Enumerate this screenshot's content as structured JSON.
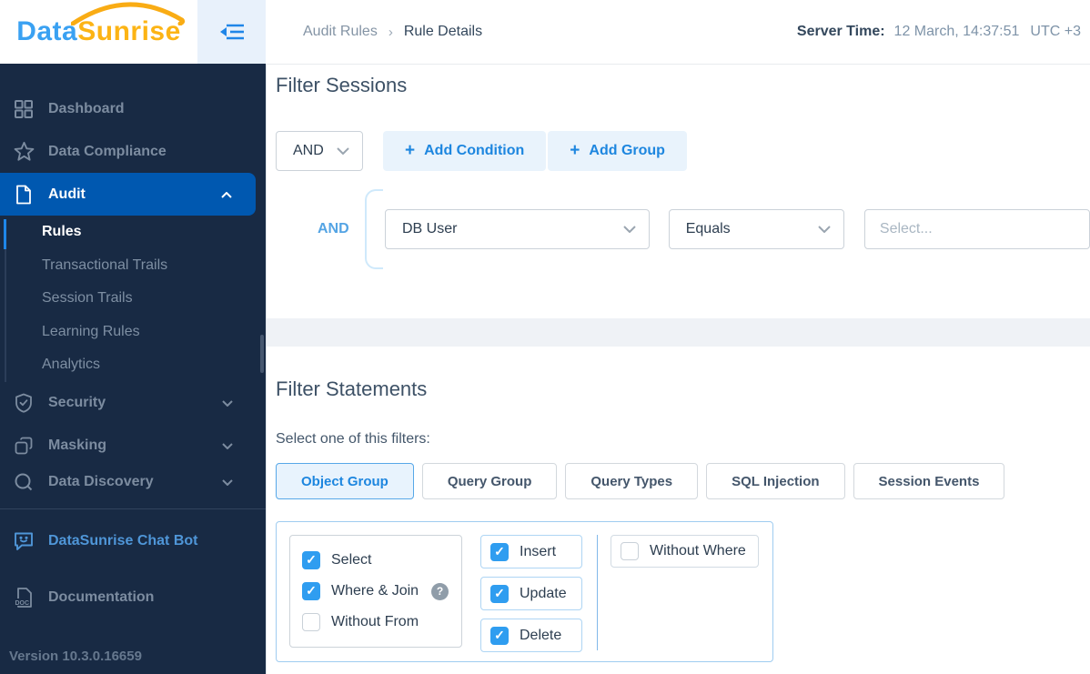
{
  "header": {
    "logo": {
      "part1": "Data",
      "part2": "Sunrise"
    },
    "breadcrumb": {
      "parent": "Audit Rules",
      "separator": "›",
      "current": "Rule Details"
    },
    "server_time_label": "Server Time:",
    "server_time_value": "12 March, 14:37:51",
    "server_time_zone": "UTC +3"
  },
  "sidebar": {
    "items": [
      {
        "label": "Dashboard",
        "icon": "dashboard-grid-icon",
        "active": false
      },
      {
        "label": "Data Compliance",
        "icon": "star-icon",
        "active": false
      },
      {
        "label": "Audit",
        "icon": "document-icon",
        "active": true,
        "expanded": true
      },
      {
        "label": "Security",
        "icon": "shield-check-icon",
        "active": false
      },
      {
        "label": "Masking",
        "icon": "masking-icon",
        "active": false
      },
      {
        "label": "Data Discovery",
        "icon": "search-icon",
        "active": false
      }
    ],
    "audit_subitems": [
      {
        "label": "Rules",
        "active": true
      },
      {
        "label": "Transactional Trails",
        "active": false
      },
      {
        "label": "Session Trails",
        "active": false
      },
      {
        "label": "Learning Rules",
        "active": false
      },
      {
        "label": "Analytics",
        "active": false
      }
    ],
    "footer_items": [
      {
        "label": "DataSunrise Chat Bot",
        "icon": "chat-bot-icon"
      },
      {
        "label": "Documentation",
        "icon": "doc-file-icon"
      }
    ],
    "version": "Version 10.3.0.16659"
  },
  "filter_sessions": {
    "title": "Filter Sessions",
    "logic_operator": "AND",
    "plus": "+",
    "add_condition_label": "Add Condition",
    "add_group_label": "Add Group",
    "condition": {
      "connector": "AND",
      "field": "DB User",
      "operator": "Equals",
      "value_placeholder": "Select..."
    }
  },
  "filter_statements": {
    "title": "Filter Statements",
    "subtitle": "Select one of this filters:",
    "tabs": [
      {
        "label": "Object Group",
        "active": true
      },
      {
        "label": "Query Group",
        "active": false
      },
      {
        "label": "Query Types",
        "active": false
      },
      {
        "label": "SQL Injection",
        "active": false
      },
      {
        "label": "Session Events",
        "active": false
      }
    ],
    "object_group": {
      "left_options": [
        {
          "label": "Select",
          "checked": true
        },
        {
          "label": "Where & Join",
          "checked": true,
          "help": true
        },
        {
          "label": "Without From",
          "checked": false
        }
      ],
      "middle_options": [
        {
          "label": "Insert",
          "checked": true
        },
        {
          "label": "Update",
          "checked": true
        },
        {
          "label": "Delete",
          "checked": true
        }
      ],
      "right_options": [
        {
          "label": "Without Where",
          "checked": false
        }
      ]
    }
  },
  "colors": {
    "accent_blue": "#1d86df",
    "sidebar_bg": "#182a44",
    "sidebar_active_bg": "#0058b0",
    "checkbox_blue": "#2f9df0",
    "logo_blue": "#3aa1f2",
    "logo_orange": "#fcb415",
    "panel_border": "#9fccf0"
  }
}
